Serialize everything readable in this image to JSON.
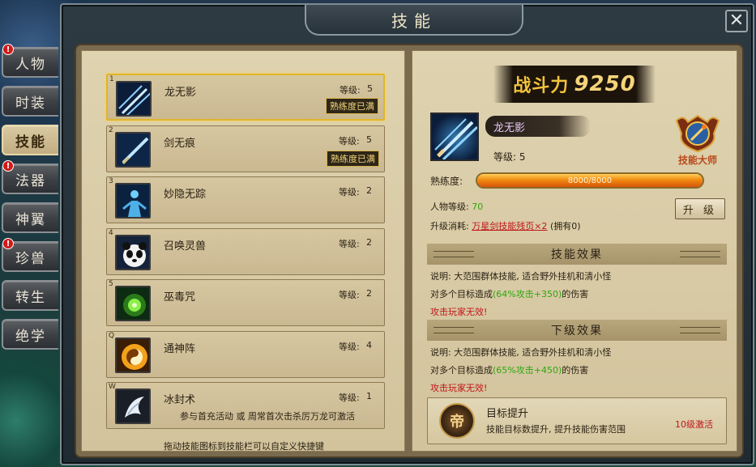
{
  "window": {
    "title": "技能",
    "close_glyph": "✕"
  },
  "sidebar": {
    "items": [
      {
        "label": "人物",
        "alert": true,
        "active": false
      },
      {
        "label": "时装",
        "alert": false,
        "active": false
      },
      {
        "label": "技能",
        "alert": false,
        "active": true
      },
      {
        "label": "法器",
        "alert": true,
        "active": false
      },
      {
        "label": "神翼",
        "alert": false,
        "active": false
      },
      {
        "label": "珍兽",
        "alert": true,
        "active": false
      },
      {
        "label": "转生",
        "alert": false,
        "active": false
      },
      {
        "label": "绝学",
        "alert": false,
        "active": false
      }
    ],
    "alert_glyph": "!"
  },
  "skills": [
    {
      "key": "1",
      "name": "龙无影",
      "level_label": "等级:",
      "level": "5",
      "badge": "熟练度已满",
      "icon": "twin-swords-icon",
      "selected": true
    },
    {
      "key": "2",
      "name": "剑无痕",
      "level_label": "等级:",
      "level": "5",
      "badge": "熟练度已满",
      "icon": "sword-icon",
      "selected": false
    },
    {
      "key": "3",
      "name": "妙隐无踪",
      "level_label": "等级:",
      "level": "2",
      "badge": "",
      "icon": "stealth-icon",
      "selected": false
    },
    {
      "key": "4",
      "name": "召唤灵兽",
      "level_label": "等级:",
      "level": "2",
      "badge": "",
      "icon": "panda-icon",
      "selected": false
    },
    {
      "key": "5",
      "name": "巫毒咒",
      "level_label": "等级:",
      "level": "2",
      "badge": "",
      "icon": "poison-icon",
      "selected": false
    },
    {
      "key": "Q",
      "name": "通神阵",
      "level_label": "等级:",
      "level": "4",
      "badge": "",
      "icon": "taiji-icon",
      "selected": false
    },
    {
      "key": "W",
      "name": "冰封术",
      "level_label": "等级:",
      "level": "1",
      "badge": "",
      "icon": "ice-icon",
      "selected": false,
      "hint": "参与首充活动 或 周常首次击杀厉万龙可激活"
    }
  ],
  "drag_hint": "拖动技能图标到技能栏可以自定义快捷键",
  "detail": {
    "power_label": "战斗力",
    "power_value": "9250",
    "name": "龙无影",
    "level_text": "等级: 5",
    "master_badge": "技能大师",
    "proficiency_label": "熟练度:",
    "proficiency_text": "8000/8000",
    "proficiency_fraction": 1.0,
    "char_level_label": "人物等级:",
    "char_level_value": "70",
    "cost_label": "升级消耗:",
    "cost_item": "万星剑技能残页×2",
    "cost_owned": "(拥有0)",
    "upgrade_button": "升 级",
    "effect_title": "技能效果",
    "effect_line1": "说明: 大范围群体技能, 适合野外挂机和清小怪",
    "effect_line2_a": "对多个目标造成",
    "effect_line2_b": "(64%攻击+350)",
    "effect_line2_c": "的伤害",
    "effect_note": "攻击玩家无效!",
    "next_title": "下级效果",
    "next_line1": "说明: 大范围群体技能, 适合野外挂机和清小怪",
    "next_line2_a": "对多个目标造成",
    "next_line2_b": "(65%攻击+450)",
    "next_line2_c": "的伤害",
    "next_note": "攻击玩家无效!",
    "target_emblem": "帝",
    "target_title": "目标提升",
    "target_desc": "技能目标数提升, 提升技能伤害范围",
    "target_req": "10级激活"
  }
}
